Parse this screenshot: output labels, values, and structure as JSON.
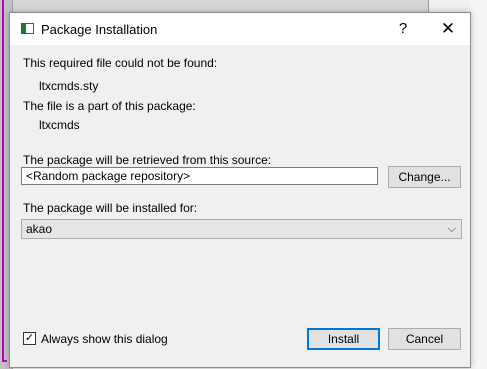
{
  "dialog": {
    "title": "Package Installation",
    "help_label": "?",
    "close_label": "✕"
  },
  "content": {
    "not_found_label": "This required file could not be found:",
    "file_name": "ltxcmds.sty",
    "part_of_label": "The file is a part of this package:",
    "package_name": "ltxcmds",
    "source_label": "The package will be retrieved from this source:",
    "source_value": "<Random package repository>",
    "change_label": "Change...",
    "install_for_label": "The package will be installed for:",
    "install_for_value": "akao",
    "select_chevron": "⌵",
    "always_show_label": "Always show this dialog",
    "always_show_checked": true,
    "checkmark": "✓",
    "install_label": "Install",
    "cancel_label": "Cancel"
  },
  "colors": {
    "accent": "#0078d7",
    "titlebar": "#ffffff",
    "dialog_bg": "#f0f0f0"
  },
  "icons": [
    "app-icon",
    "help-icon",
    "close-icon",
    "chevron-down-icon",
    "checkmark-icon"
  ]
}
